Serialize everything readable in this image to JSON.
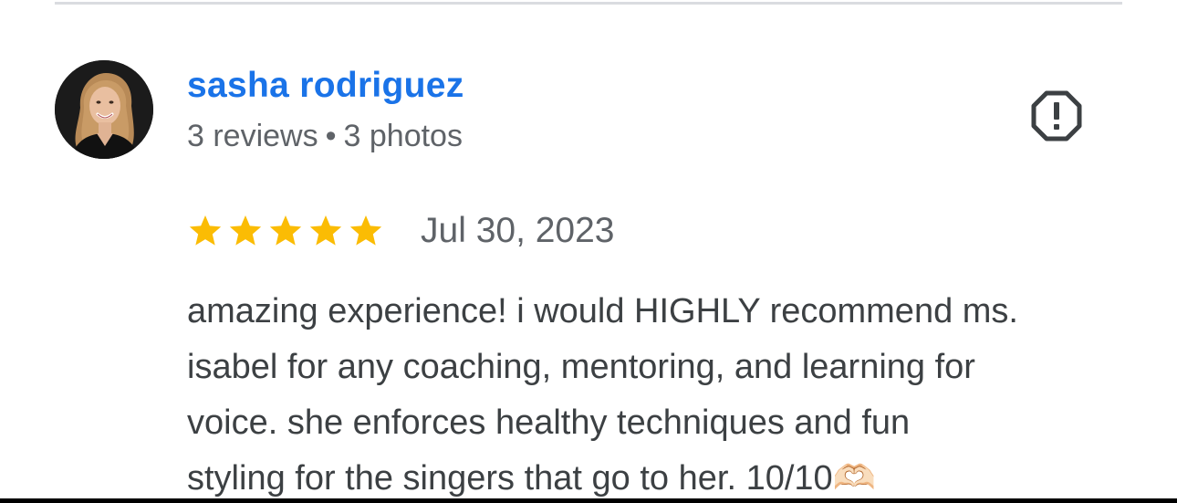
{
  "review": {
    "author": {
      "name": "sasha rodriguez",
      "reviews_count": "3 reviews",
      "separator": "•",
      "photos_count": "3 photos",
      "avatar": "avatar-photo"
    },
    "report_icon": "report-octagon-icon",
    "rating": {
      "stars": 5,
      "max_stars": 5,
      "star_icon": "star-icon",
      "star_color": "#fbbc04"
    },
    "date": "Jul 30, 2023",
    "text_lines": [
      "amazing experience! i would HIGHLY recommend ms.",
      "isabel for any coaching, mentoring, and learning for",
      "voice. she enforces healthy techniques and fun",
      "styling for the singers that go to her. 10/10🫶🏻"
    ]
  },
  "colors": {
    "link": "#1a73e8",
    "secondary_text": "#5f6368",
    "body_text": "#3c4043",
    "divider": "#dadce0",
    "icon": "#3c4043"
  }
}
